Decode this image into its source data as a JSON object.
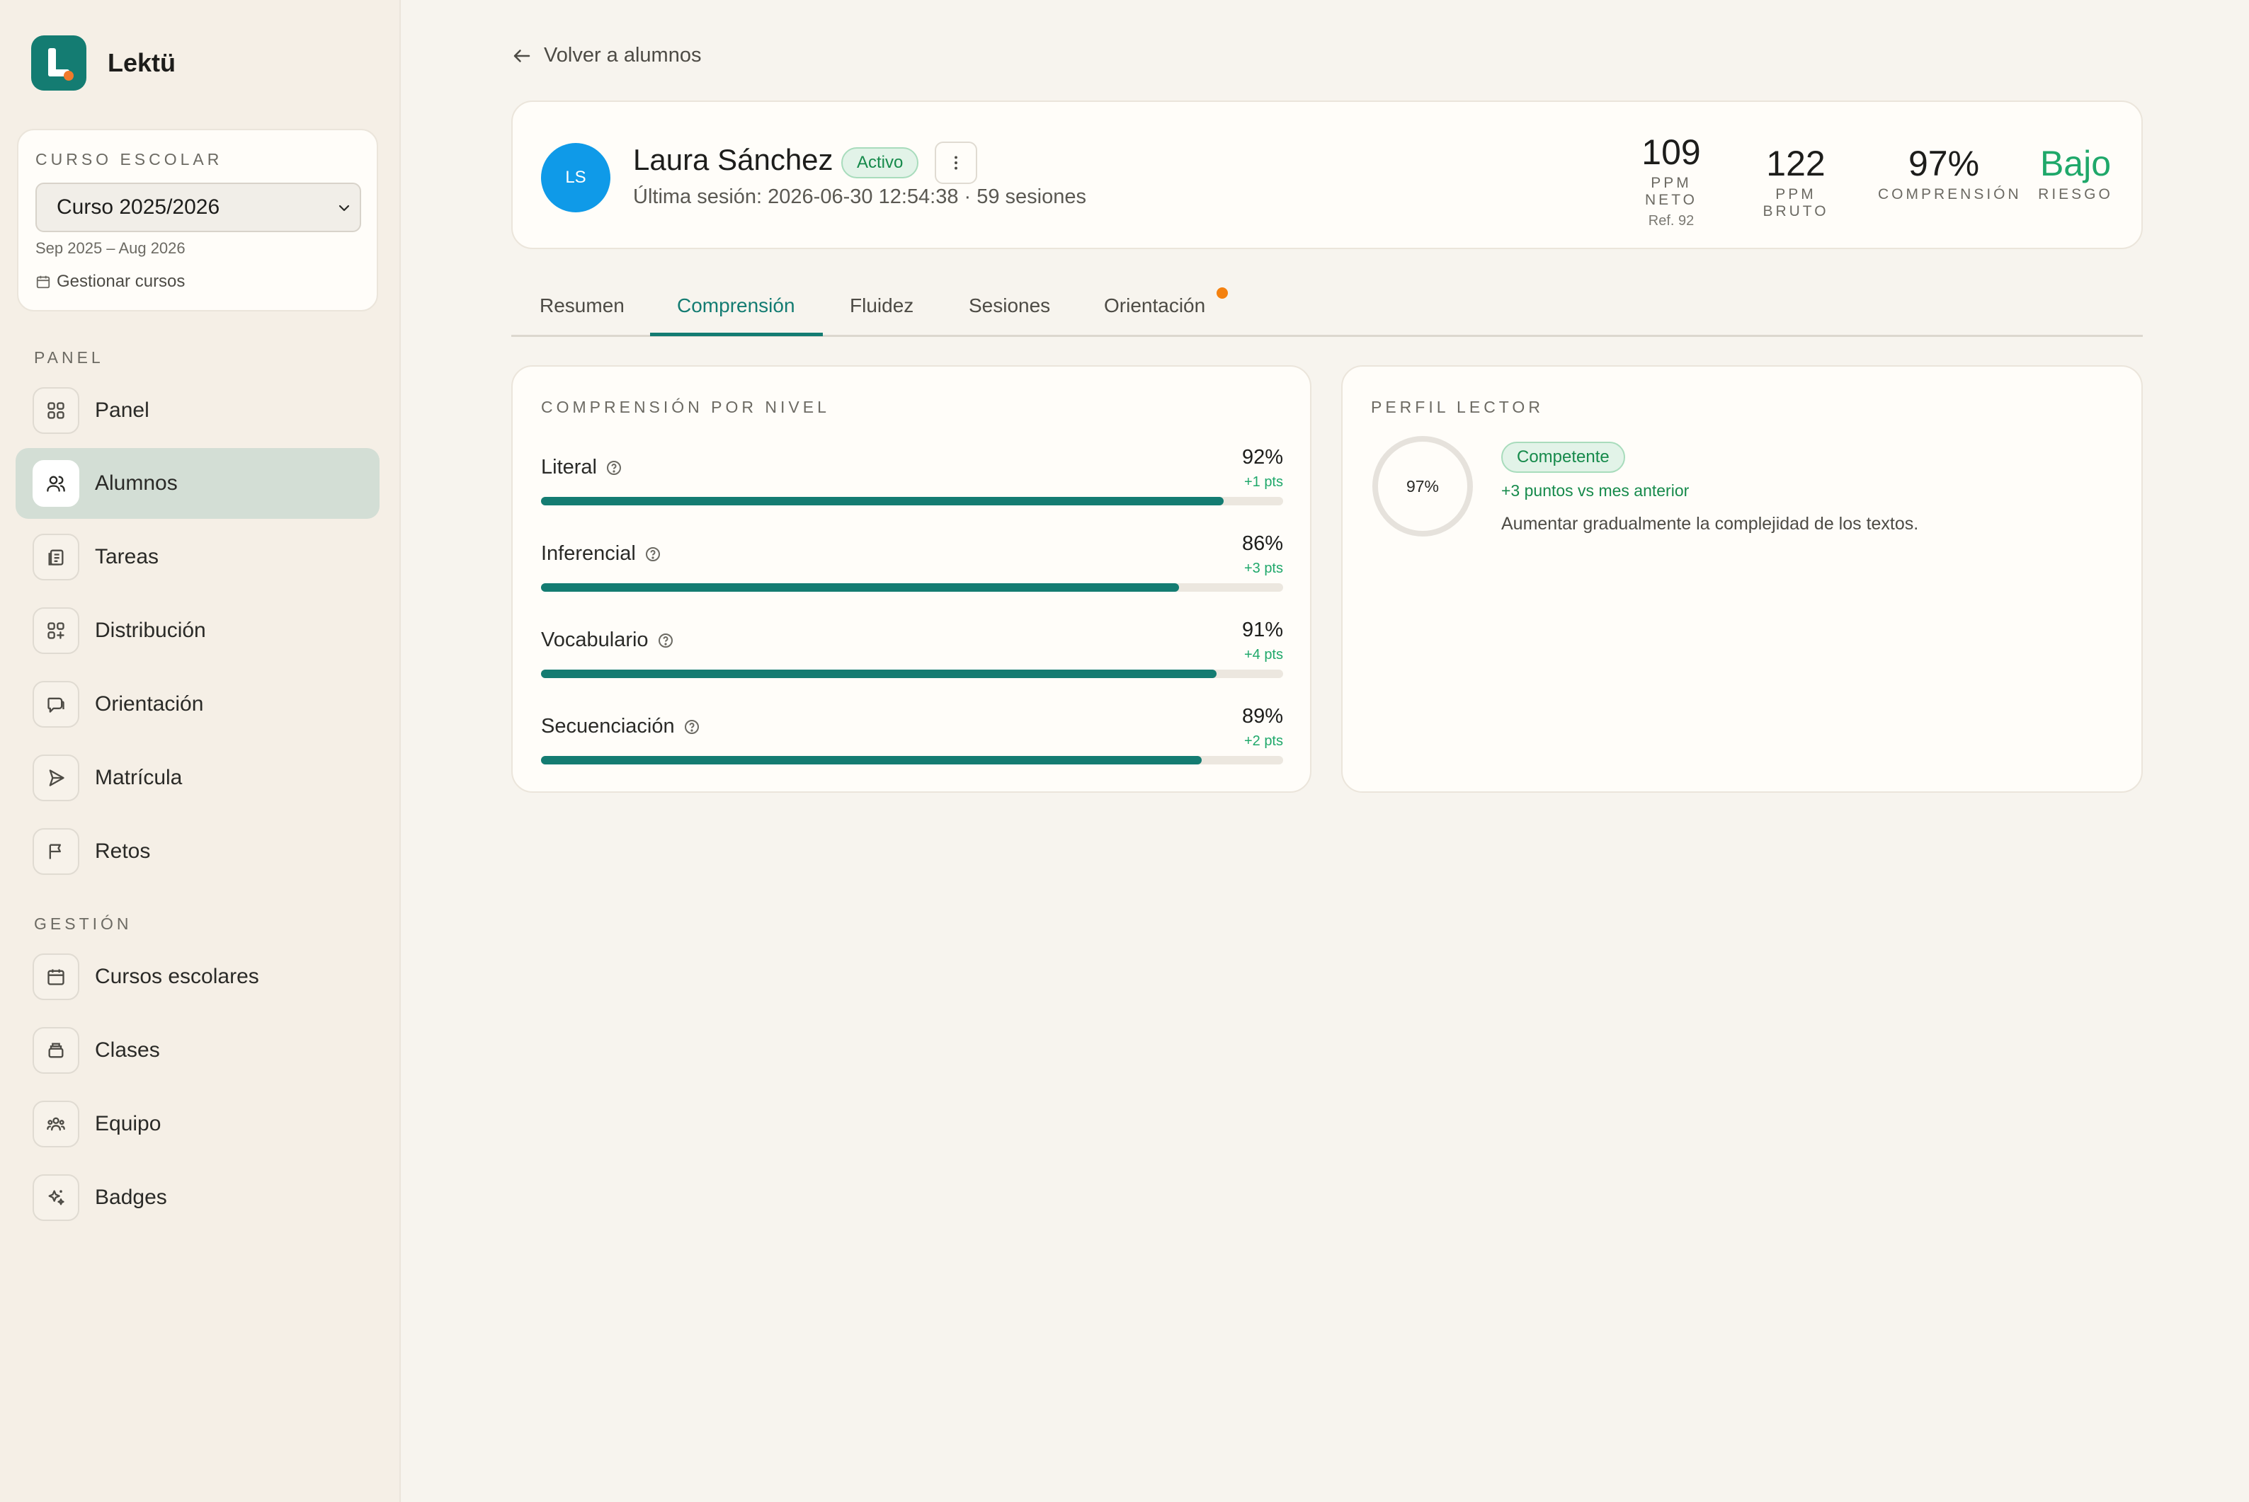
{
  "app": {
    "name": "Lektü"
  },
  "course": {
    "caption": "CURSO ESCOLAR",
    "selected": "Curso 2025/2026",
    "range": "Sep 2025 – Aug 2026",
    "manage_label": "Gestionar cursos"
  },
  "sidebar": {
    "panel_caption": "PANEL",
    "panel_items": [
      {
        "label": "Panel",
        "icon": "grid-icon"
      },
      {
        "label": "Alumnos",
        "icon": "users-icon",
        "active": true
      },
      {
        "label": "Tareas",
        "icon": "clipboard-icon"
      },
      {
        "label": "Distribución",
        "icon": "grid-plus-icon"
      },
      {
        "label": "Orientación",
        "icon": "chat-icon"
      },
      {
        "label": "Matrícula",
        "icon": "send-icon"
      },
      {
        "label": "Retos",
        "icon": "flag-icon"
      }
    ],
    "management_caption": "GESTIÓN",
    "management_items": [
      {
        "label": "Cursos escolares",
        "icon": "calendar-icon"
      },
      {
        "label": "Clases",
        "icon": "stack-icon"
      },
      {
        "label": "Equipo",
        "icon": "team-icon"
      },
      {
        "label": "Badges",
        "icon": "sparkle-icon"
      }
    ]
  },
  "back_label": "Volver a alumnos",
  "student": {
    "initials": "LS",
    "name": "Laura Sánchez",
    "status": "Activo",
    "session_info": "Última sesión: 2026-06-30 12:54:38 · 59 sesiones",
    "stats": {
      "ppm_neto": {
        "value": "109",
        "label": "PPM NETO",
        "sub": "Ref. 92"
      },
      "ppm_bruto": {
        "value": "122",
        "label": "PPM BRUTO"
      },
      "comprension": {
        "value": "97%",
        "label": "COMPRENSIÓN"
      },
      "riesgo": {
        "value": "Bajo",
        "label": "RIESGO"
      }
    }
  },
  "tabs": [
    "Resumen",
    "Comprensión",
    "Fluidez",
    "Sesiones",
    "Orientación"
  ],
  "active_tab": "Comprensión",
  "comprehension": {
    "caption": "COMPRENSIÓN POR NIVEL",
    "levels": [
      {
        "label": "Literal",
        "value": "92%",
        "delta": "+1 pts",
        "progress": 0.92
      },
      {
        "label": "Inferencial",
        "value": "86%",
        "delta": "+3 pts",
        "progress": 0.86
      },
      {
        "label": "Vocabulario",
        "value": "91%",
        "delta": "+4 pts",
        "progress": 0.91
      },
      {
        "label": "Secuenciación",
        "value": "89%",
        "delta": "+2 pts",
        "progress": 0.89
      }
    ]
  },
  "reader_profile": {
    "caption": "PERFIL LECTOR",
    "score": "97%",
    "tier": "Competente",
    "trend": "+3 puntos vs mes anterior",
    "advice": "Aumentar gradualmente la complejidad de los textos."
  },
  "colors": {
    "accent": "#147c72",
    "active_nav": "#d3ded5",
    "avatar": "#0f9ae8",
    "positive": "#1fa86a",
    "notification_dot": "#f4810f"
  }
}
